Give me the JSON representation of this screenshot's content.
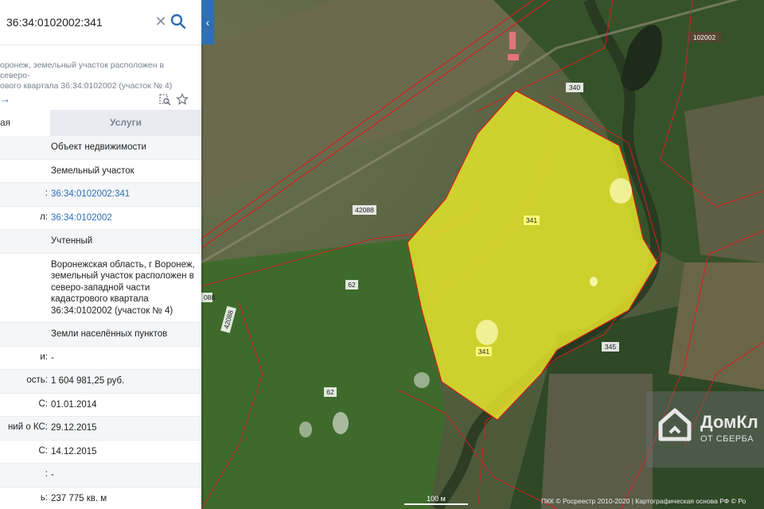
{
  "search": {
    "query": "36:34:0102002:341"
  },
  "parcel": {
    "address_line": "оронеж, земельный участок расположен в северо-\nового квартала 36:34:0102002 (участок № 4)"
  },
  "tabs": {
    "services": "Услуги",
    "info_fragment": "ая"
  },
  "rows": [
    {
      "key": "",
      "value": "Объект недвижимости"
    },
    {
      "key": "",
      "value": "Земельный участок"
    },
    {
      "key": ":",
      "value": "36:34:0102002:341"
    },
    {
      "key": "л:",
      "value": "36:34:0102002"
    },
    {
      "key": "",
      "value": "Учтенный"
    },
    {
      "key": "",
      "value": "Воронежская область, г Воронеж, земельный участок расположен в северо-западной части кадастрового квартала 36:34:0102002 (участок № 4)"
    },
    {
      "key": "",
      "value": "Земли населённых пунктов"
    },
    {
      "key": "и:",
      "value": "-"
    },
    {
      "key": "ость:",
      "value": "1 604 981,25 руб."
    },
    {
      "key": "С:",
      "value": "01.01.2014"
    },
    {
      "key": "ний о КС:",
      "value": "29.12.2015"
    },
    {
      "key": "С:",
      "value": "14.12.2015"
    },
    {
      "key": ":",
      "value": "-"
    },
    {
      "key": "ь:",
      "value": "237 775 кв. м"
    }
  ],
  "map": {
    "labels": {
      "l102002": "102002",
      "l340": "340",
      "l42088a": "42088",
      "l42088b": "42088",
      "l088": "088",
      "l62a": "62",
      "l62b": "62",
      "l341a": "341",
      "l341b": "341",
      "l345": "345"
    },
    "colors": {
      "parcel_fill": "#e9e92a",
      "boundary": "#d42020"
    },
    "scale_label": "100 м",
    "copyright": "ПКК © Росреестр 2010-2020 | Картографическая основа РФ © Ро",
    "watermark": {
      "title": "ДомКл",
      "subtitle": "ОТ СБЕРБА"
    }
  }
}
